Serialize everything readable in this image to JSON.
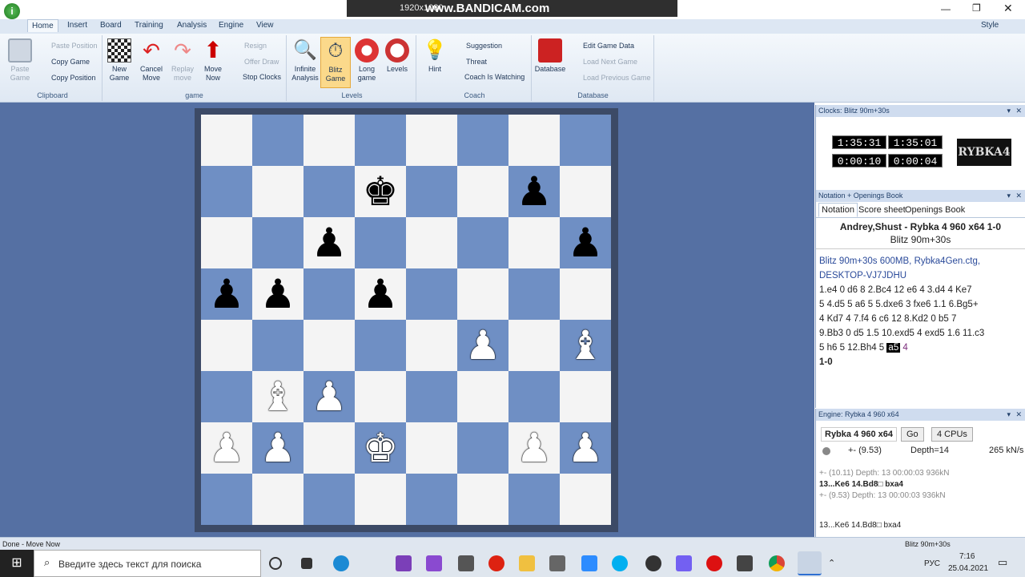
{
  "titlebar": {
    "style_label": "Style"
  },
  "bandicam": {
    "resolution": "1920x1080",
    "brand": "www.BANDICAM.com"
  },
  "ribbon": {
    "tabs": [
      "Home",
      "Insert",
      "Board",
      "Training",
      "Analysis",
      "Engine",
      "View"
    ],
    "clipboard": {
      "paste": "Paste Game",
      "paste_position": "Paste Position",
      "copy_game": "Copy Game",
      "copy_position": "Copy Position",
      "caption": "Clipboard"
    },
    "game": {
      "new_game": "New Game",
      "cancel_move": "Cancel Move",
      "replay_move": "Replay move",
      "move_now": "Move Now",
      "resign": "Resign",
      "offer_draw": "Offer Draw",
      "stop_clocks": "Stop Clocks",
      "caption": "game"
    },
    "levels": {
      "infinite": "Infinite Analysis",
      "blitz": "Blitz Game",
      "long": "Long game",
      "levels": "Levels",
      "caption": "Levels"
    },
    "coach": {
      "hint": "Hint",
      "suggestion": "Suggestion",
      "threat": "Threat",
      "coach_watching": "Coach Is Watching",
      "caption": "Coach"
    },
    "database": {
      "database": "Database",
      "edit": "Edit Game Data",
      "load_next": "Load Next Game",
      "load_prev": "Load Previous Game",
      "caption": "Database"
    }
  },
  "board": {
    "pieces": [
      {
        "sq": "d7",
        "glyph": "♚",
        "color": "b"
      },
      {
        "sq": "g7",
        "glyph": "♟",
        "color": "b"
      },
      {
        "sq": "c6",
        "glyph": "♟",
        "color": "b"
      },
      {
        "sq": "h6",
        "glyph": "♟",
        "color": "b"
      },
      {
        "sq": "a5",
        "glyph": "♟",
        "color": "b"
      },
      {
        "sq": "b5",
        "glyph": "♟",
        "color": "b"
      },
      {
        "sq": "d5",
        "glyph": "♟",
        "color": "b"
      },
      {
        "sq": "f4",
        "glyph": "♟",
        "color": "w"
      },
      {
        "sq": "h4",
        "glyph": "♝",
        "color": "w"
      },
      {
        "sq": "b3",
        "glyph": "♝",
        "color": "w"
      },
      {
        "sq": "c3",
        "glyph": "♟",
        "color": "w"
      },
      {
        "sq": "a2",
        "glyph": "♟",
        "color": "w"
      },
      {
        "sq": "b2",
        "glyph": "♟",
        "color": "w"
      },
      {
        "sq": "d2",
        "glyph": "♚",
        "color": "w"
      },
      {
        "sq": "g2",
        "glyph": "♟",
        "color": "w"
      },
      {
        "sq": "h2",
        "glyph": "♟",
        "color": "w"
      }
    ]
  },
  "clocks": {
    "title": "Clocks: Blitz 90m+30s",
    "white_time": "1:35:31",
    "black_time": "1:35:01",
    "white_inc": "0:00:10",
    "black_inc": "0:00:04",
    "logo": "RYBKA4"
  },
  "notation": {
    "title": "Notation + Openings Book",
    "tabs": [
      "Notation",
      "Score sheet",
      "Openings Book"
    ],
    "players": "Andrey,Shust - Rybka 4 960 x64  1-0",
    "event": "Blitz 90m+30s",
    "header": "Blitz 90m+30s  600MB, Rybka4Gen.ctg, DESKTOP-VJ7JDHU",
    "lines": [
      "1.e4  0  d6  8  2.Bc4  12  e6  4  3.d4  4  Ke7",
      "5  4.d5  5  a6  5  5.dxe6  3  fxe6  1.1  6.Bg5+",
      "4  Kd7  4  7.f4  6  c6  12  8.Kd2  0  b5  7",
      "9.Bb3  0  d5  1.5  10.exd5  4  exd5  1.6  11.c3",
      "5  h6  5  12.Bh4  5"
    ],
    "current": "a5",
    "after": "4",
    "result": "1-0"
  },
  "engine": {
    "title": "Engine: Rybka 4 960 x64",
    "name": "Rybka 4 960 x64",
    "go": "Go",
    "cpus": "4 CPUs",
    "eval": "+-  (9.53)",
    "depth": "Depth=14",
    "speed": "265 kN/s",
    "line1": "+-  (10.11)  Depth: 13  00:00:03  936kN",
    "line2": "13...Ke6 14.Bd8□ bxa4",
    "line3": "+-  (9.53)  Depth: 13  00:00:03  936kN",
    "bottom": "13...Ke6 14.Bd8□ bxa4"
  },
  "status": {
    "left": "Done - Move Now",
    "right": "Blitz 90m+30s"
  },
  "taskbar": {
    "search_placeholder": "Введите здесь текст для поиска",
    "lang": "РУС",
    "time": "7:16",
    "date": "25.04.2021"
  }
}
